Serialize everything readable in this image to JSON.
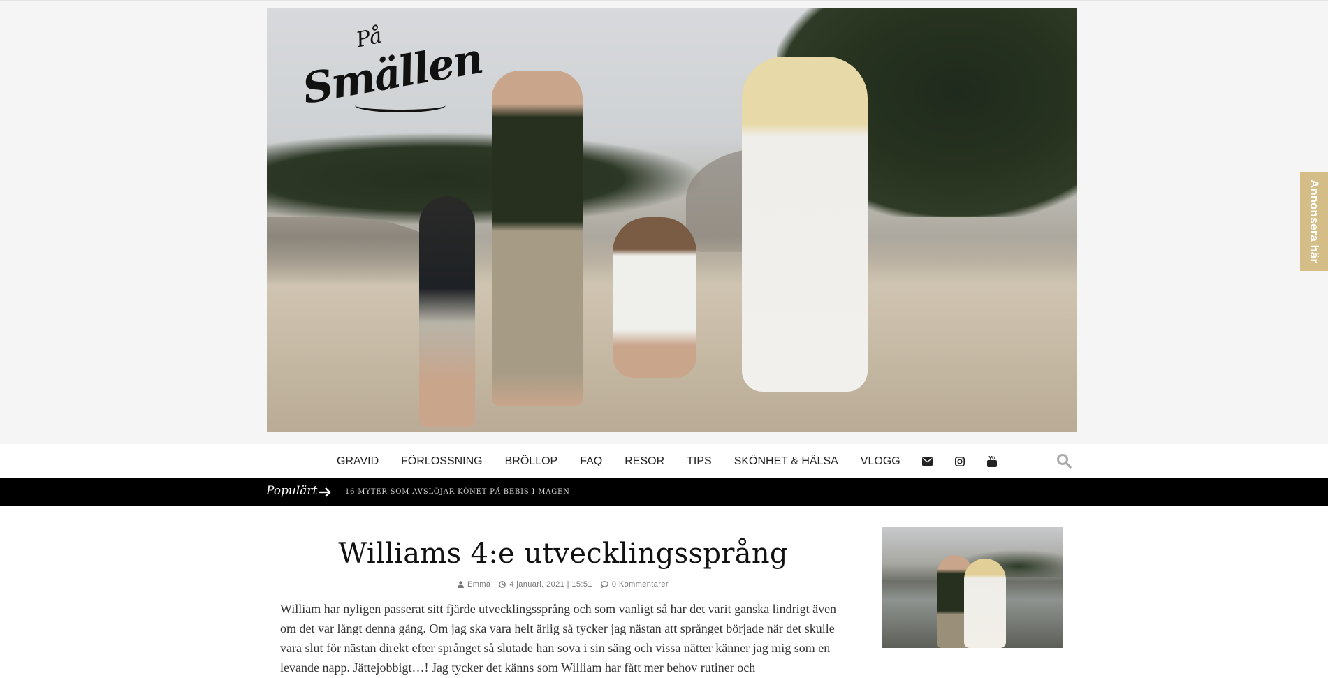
{
  "site": {
    "logo_small": "På",
    "logo_main": "Smällen",
    "side_tab_label": "Annonsera här"
  },
  "nav": {
    "items": [
      "Gravid",
      "Förlossning",
      "Bröllop",
      "FAQ",
      "Resor",
      "Tips",
      "Skönhet & hälsa",
      "Vlogg"
    ],
    "icons": [
      "envelope-icon",
      "instagram-icon",
      "youtube-icon"
    ],
    "search_icon": "search-icon"
  },
  "popular": {
    "label": "Populärt",
    "link": "16 myter som avslöjar könet på bebis i magen"
  },
  "post": {
    "title": "Williams 4:e utvecklingssprång",
    "author": "Emma",
    "date": "4 januari, 2021 | 15:51",
    "comments": "0 Kommentarer",
    "body": "William har nyligen passerat sitt fjärde utvecklingssprång och som vanligt så har det varit ganska lindrigt även om det var långt denna gång. Om jag ska vara helt ärlig så tycker jag nästan att språnget började när det skulle vara slut för nästan direkt efter språnget så slutade han sova i sin säng och vissa nätter känner jag mig som en levande napp. Jättejobbigt…! Jag tycker det känns som William har fått mer behov rutiner och"
  },
  "colors": {
    "nav_bg": "#ffffff",
    "popular_bg": "#000000",
    "side_tab_bg": "#d4bd86",
    "page_bg": "#f5f5f5"
  }
}
